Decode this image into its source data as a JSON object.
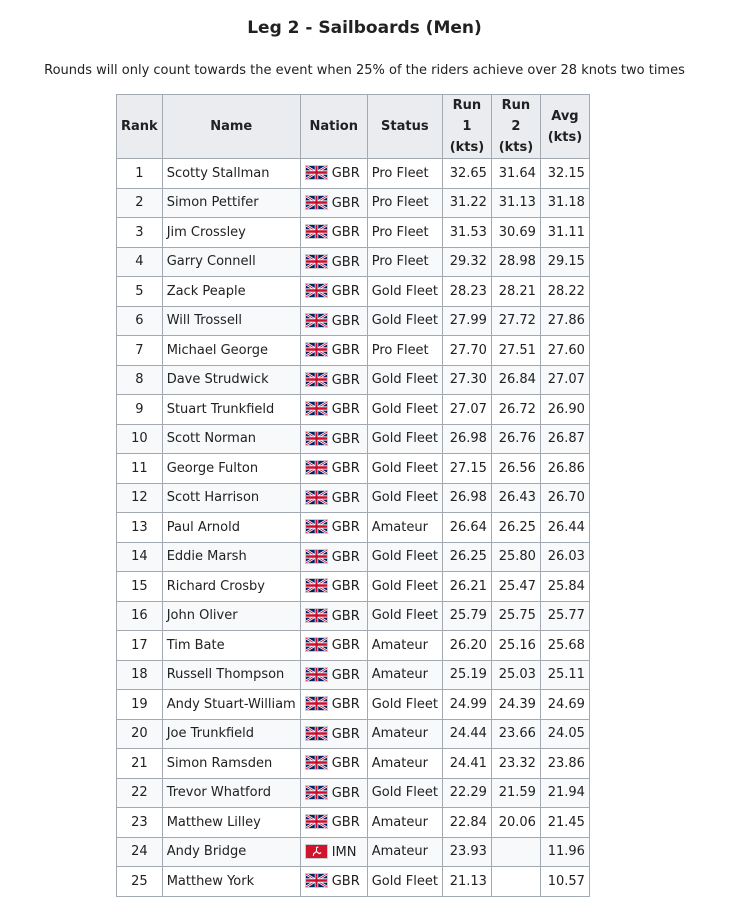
{
  "title": "Leg 2 - Sailboards (Men)",
  "note": "Rounds will only count towards the event when 25% of the riders achieve over 28 knots two times",
  "columns": {
    "rank": "Rank",
    "name": "Name",
    "nation": "Nation",
    "status": "Status",
    "run1": "Run 1",
    "run2": "Run 2",
    "avg": "Avg",
    "unit": "(kts)"
  },
  "icons": {
    "GBR": "union-jack-flag-icon",
    "IMN": "isle-of-man-flag-icon"
  },
  "rows": [
    {
      "rank": "1",
      "name": "Scotty Stallman",
      "nation": "GBR",
      "status": "Pro Fleet",
      "run1": "32.65",
      "run2": "31.64",
      "avg": "32.15"
    },
    {
      "rank": "2",
      "name": "Simon Pettifer",
      "nation": "GBR",
      "status": "Pro Fleet",
      "run1": "31.22",
      "run2": "31.13",
      "avg": "31.18"
    },
    {
      "rank": "3",
      "name": "Jim Crossley",
      "nation": "GBR",
      "status": "Pro Fleet",
      "run1": "31.53",
      "run2": "30.69",
      "avg": "31.11"
    },
    {
      "rank": "4",
      "name": "Garry Connell",
      "nation": "GBR",
      "status": "Pro Fleet",
      "run1": "29.32",
      "run2": "28.98",
      "avg": "29.15"
    },
    {
      "rank": "5",
      "name": "Zack Peaple",
      "nation": "GBR",
      "status": "Gold Fleet",
      "run1": "28.23",
      "run2": "28.21",
      "avg": "28.22"
    },
    {
      "rank": "6",
      "name": "Will Trossell",
      "nation": "GBR",
      "status": "Gold Fleet",
      "run1": "27.99",
      "run2": "27.72",
      "avg": "27.86"
    },
    {
      "rank": "7",
      "name": "Michael George",
      "nation": "GBR",
      "status": "Pro Fleet",
      "run1": "27.70",
      "run2": "27.51",
      "avg": "27.60"
    },
    {
      "rank": "8",
      "name": "Dave Strudwick",
      "nation": "GBR",
      "status": "Gold Fleet",
      "run1": "27.30",
      "run2": "26.84",
      "avg": "27.07"
    },
    {
      "rank": "9",
      "name": "Stuart Trunkfield",
      "nation": "GBR",
      "status": "Gold Fleet",
      "run1": "27.07",
      "run2": "26.72",
      "avg": "26.90"
    },
    {
      "rank": "10",
      "name": "Scott Norman",
      "nation": "GBR",
      "status": "Gold Fleet",
      "run1": "26.98",
      "run2": "26.76",
      "avg": "26.87"
    },
    {
      "rank": "11",
      "name": "George Fulton",
      "nation": "GBR",
      "status": "Gold Fleet",
      "run1": "27.15",
      "run2": "26.56",
      "avg": "26.86"
    },
    {
      "rank": "12",
      "name": "Scott Harrison",
      "nation": "GBR",
      "status": "Gold Fleet",
      "run1": "26.98",
      "run2": "26.43",
      "avg": "26.70"
    },
    {
      "rank": "13",
      "name": "Paul Arnold",
      "nation": "GBR",
      "status": "Amateur",
      "run1": "26.64",
      "run2": "26.25",
      "avg": "26.44"
    },
    {
      "rank": "14",
      "name": "Eddie Marsh",
      "nation": "GBR",
      "status": "Gold Fleet",
      "run1": "26.25",
      "run2": "25.80",
      "avg": "26.03"
    },
    {
      "rank": "15",
      "name": "Richard Crosby",
      "nation": "GBR",
      "status": "Gold Fleet",
      "run1": "26.21",
      "run2": "25.47",
      "avg": "25.84"
    },
    {
      "rank": "16",
      "name": "John Oliver",
      "nation": "GBR",
      "status": "Gold Fleet",
      "run1": "25.79",
      "run2": "25.75",
      "avg": "25.77"
    },
    {
      "rank": "17",
      "name": "Tim Bate",
      "nation": "GBR",
      "status": "Amateur",
      "run1": "26.20",
      "run2": "25.16",
      "avg": "25.68"
    },
    {
      "rank": "18",
      "name": "Russell Thompson",
      "nation": "GBR",
      "status": "Amateur",
      "run1": "25.19",
      "run2": "25.03",
      "avg": "25.11"
    },
    {
      "rank": "19",
      "name": "Andy Stuart-William",
      "nation": "GBR",
      "status": "Gold Fleet",
      "run1": "24.99",
      "run2": "24.39",
      "avg": "24.69"
    },
    {
      "rank": "20",
      "name": "Joe Trunkfield",
      "nation": "GBR",
      "status": "Amateur",
      "run1": "24.44",
      "run2": "23.66",
      "avg": "24.05"
    },
    {
      "rank": "21",
      "name": "Simon Ramsden",
      "nation": "GBR",
      "status": "Amateur",
      "run1": "24.41",
      "run2": "23.32",
      "avg": "23.86"
    },
    {
      "rank": "22",
      "name": "Trevor Whatford",
      "nation": "GBR",
      "status": "Gold Fleet",
      "run1": "22.29",
      "run2": "21.59",
      "avg": "21.94"
    },
    {
      "rank": "23",
      "name": "Matthew Lilley",
      "nation": "GBR",
      "status": "Amateur",
      "run1": "22.84",
      "run2": "20.06",
      "avg": "21.45"
    },
    {
      "rank": "24",
      "name": "Andy Bridge",
      "nation": "IMN",
      "status": "Amateur",
      "run1": "23.93",
      "run2": "",
      "avg": "11.96"
    },
    {
      "rank": "25",
      "name": "Matthew York",
      "nation": "GBR",
      "status": "Gold Fleet",
      "run1": "21.13",
      "run2": "",
      "avg": "10.57"
    }
  ]
}
